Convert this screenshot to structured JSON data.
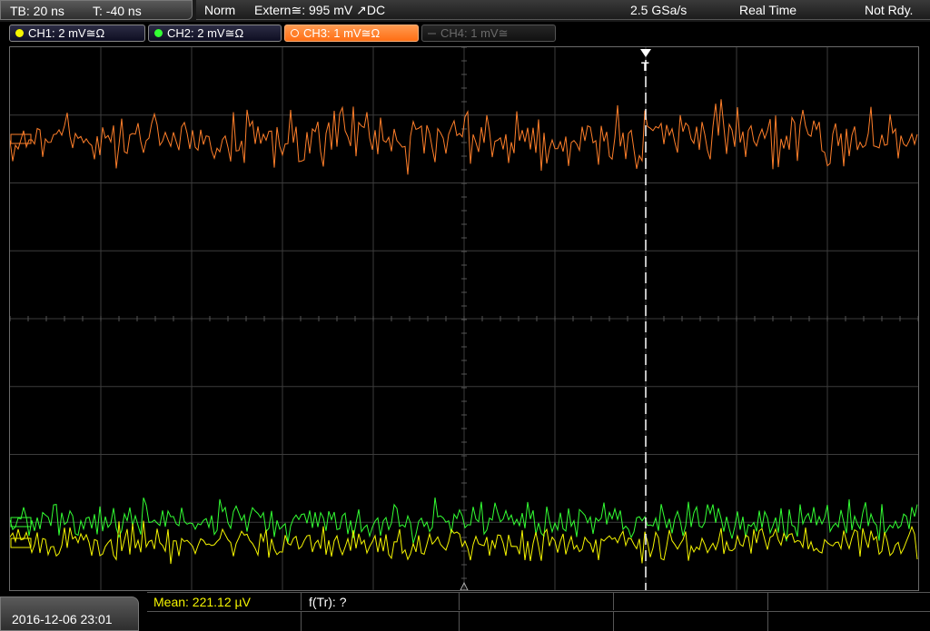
{
  "timebase": {
    "tb": "TB: 20 ns",
    "t": "T: -40 ns"
  },
  "status": {
    "mode": "Norm",
    "trigger": "Extern≅: 995 mV ↗DC",
    "sample_rate": "2.5 GSa/s",
    "acq": "Real Time",
    "state": "Not Rdy."
  },
  "channels": [
    {
      "label": "CH1: 2 mV≅Ω",
      "color": "#f5f500",
      "active": false
    },
    {
      "label": "CH2: 2 mV≅Ω",
      "color": "#33ff33",
      "active": false
    },
    {
      "label": "CH3: 1 mV≅Ω",
      "color": "#ff7f2a",
      "active": true
    },
    {
      "label": "CH4: 1 mV≅",
      "color": "#777777",
      "active": false,
      "disabled": true
    }
  ],
  "trigger_marker": "T",
  "measurements": {
    "mean": "Mean: 221.12 µV",
    "ftr": "f(Tr): ?"
  },
  "datetime": "2016-12-06 23:01",
  "colors": {
    "ch1": "#f5f500",
    "ch2": "#33ff33",
    "ch3": "#ff7f2a",
    "grid": "#3c3c3c",
    "trigger_line": "#ffffff"
  }
}
